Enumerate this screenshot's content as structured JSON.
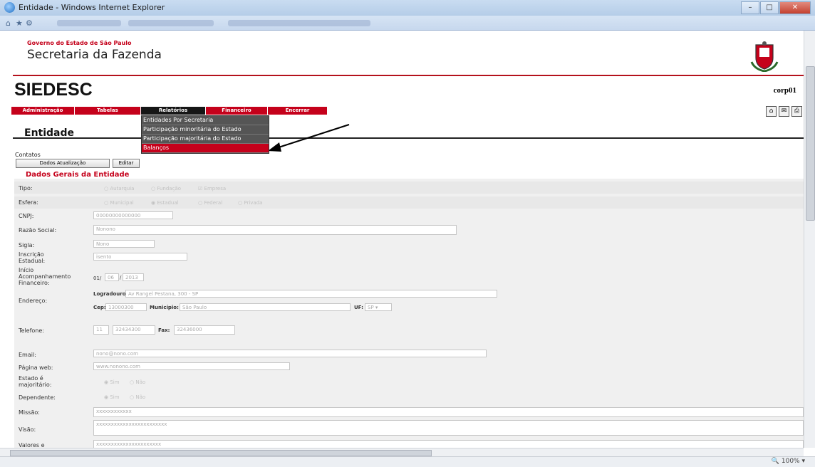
{
  "window": {
    "title": "Entidade - Windows Internet Explorer"
  },
  "header": {
    "gov_line": "Governo do Estado de São Paulo",
    "dept": "Secretaria da Fazenda",
    "brand": "SIEDESC",
    "user": "corp01"
  },
  "menu": {
    "items": [
      "Administração",
      "Tabelas",
      "Relatórios",
      "Financeiro",
      "Encerrar"
    ],
    "active": "Relatórios",
    "dropdown": [
      "Entidades Por Secretaria",
      "Participação minoritária do Estado",
      "Participação majoritária do Estado",
      "Balanços"
    ],
    "highlighted": "Balanços"
  },
  "page": {
    "title": "Entidade",
    "contatos": "Contatos",
    "btn_update": "Dados Atualização",
    "btn_edit": "Editar",
    "section": "Dados Gerais da Entidade"
  },
  "form": {
    "tipo_label": "Tipo:",
    "tipo_options": [
      "Autarquia",
      "Fundação",
      "Empresa"
    ],
    "esfera_label": "Esfera:",
    "esfera_options": [
      "Municipal",
      "Estadual",
      "Federal",
      "Privada"
    ],
    "cnpj_label": "CNPJ:",
    "cnpj": "00000000000000",
    "razao_label": "Razão Social:",
    "razao": "Nonono",
    "sigla_label": "Sigla:",
    "sigla": "Nono",
    "ie_label": "Inscrição Estadual:",
    "ie": "isento",
    "inicio_label": "Início Acompanhamento Financeiro:",
    "inicio_d": "01/",
    "inicio_m": "06",
    "inicio_sep": "/",
    "inicio_y": "2013",
    "endereco_label": "Endereço:",
    "logradouro_label": "Logradouro:",
    "logradouro": "Av Rangel Pestana, 300 - SP",
    "cep_label": "Cep:",
    "cep": "13000300",
    "municipio_label": "Município:",
    "municipio": "São Paulo",
    "uf_label": "UF:",
    "uf": "SP",
    "telefone_label": "Telefone:",
    "ddd": "11",
    "telefone": "32434300",
    "fax_label": "Fax:",
    "fax": "32436000",
    "email_label": "Email:",
    "email": "nono@nono.com",
    "web_label": "Página web:",
    "web": "www.nonono.com",
    "majoritario_label": "Estado é majoritário:",
    "dependente_label": "Dependente:",
    "sim_nao": [
      "Sim",
      "Não"
    ],
    "missao_label": "Missão:",
    "missao": "xxxxxxxxxxxx",
    "visao_label": "Visão:",
    "visao": "xxxxxxxxxxxxxxxxxxxxxxxx",
    "valores_label": "Valores e",
    "valores": "xxxxxxxxxxxxxxxxxxxxxx"
  },
  "status": {
    "zoom": "100%"
  },
  "colors": {
    "brand_red": "#c5011b",
    "menu_active": "#161616"
  }
}
